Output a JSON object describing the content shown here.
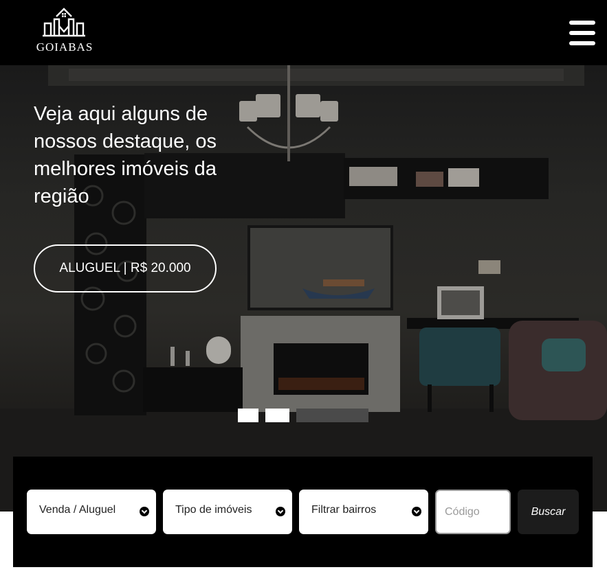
{
  "header": {
    "logo_text": "GOIABAS",
    "menu_icon": "hamburger-menu-icon"
  },
  "hero": {
    "title": "Veja aqui alguns de nossos destaque, os melhores imóveis da região",
    "button_label": "ALUGUEL | R$ 20.000",
    "slides": 3,
    "active_slide": 3
  },
  "search": {
    "deal_type": "Venda / Aluguel",
    "property_type": "Tipo de imóveis",
    "neighborhood": "Filtrar bairros",
    "code_placeholder": "Código",
    "submit_label": "Buscar"
  },
  "colors": {
    "header_bg": "#000000",
    "search_bg": "#000000",
    "button_bg": "#1c1c1c",
    "accent": "#ffffff"
  }
}
